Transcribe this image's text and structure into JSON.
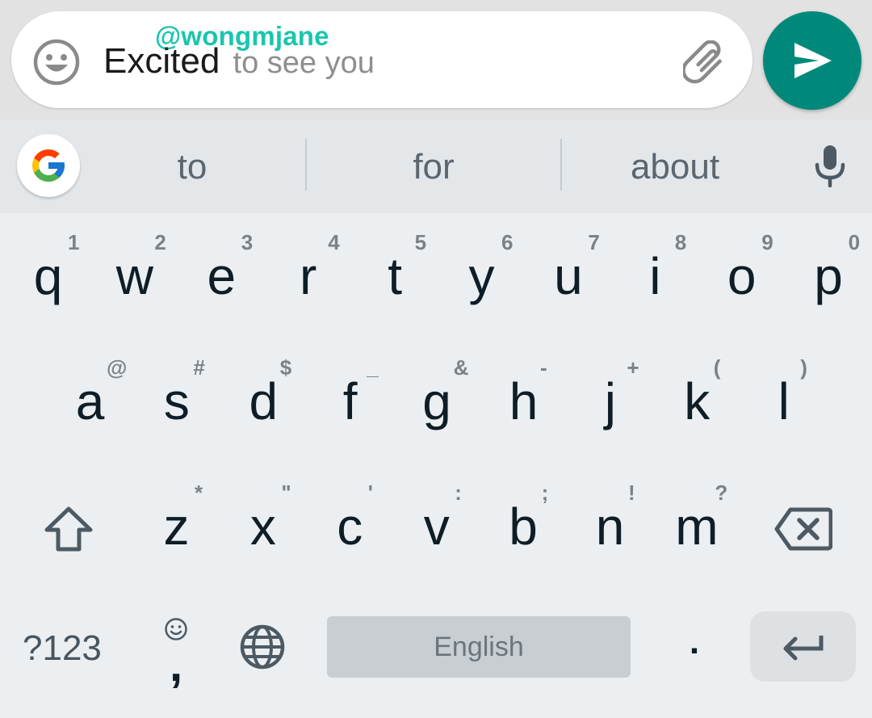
{
  "compose": {
    "mention": "@wongmjane",
    "typed_text": "Excited",
    "completion_text": "to see you",
    "emoji_icon": "smiley-face-icon",
    "attach_icon": "paperclip-icon",
    "send_icon": "send-arrow-icon",
    "send_color": "#00897b",
    "mention_color": "#1bc5ad"
  },
  "suggestions": {
    "google_icon": "google-g-icon",
    "items": [
      "to",
      "for",
      "about"
    ],
    "mic_icon": "microphone-icon"
  },
  "keyboard": {
    "row1": [
      {
        "key": "q",
        "hint": "1"
      },
      {
        "key": "w",
        "hint": "2"
      },
      {
        "key": "e",
        "hint": "3"
      },
      {
        "key": "r",
        "hint": "4"
      },
      {
        "key": "t",
        "hint": "5"
      },
      {
        "key": "y",
        "hint": "6"
      },
      {
        "key": "u",
        "hint": "7"
      },
      {
        "key": "i",
        "hint": "8"
      },
      {
        "key": "o",
        "hint": "9"
      },
      {
        "key": "p",
        "hint": "0"
      }
    ],
    "row2": [
      {
        "key": "a",
        "hint": "@"
      },
      {
        "key": "s",
        "hint": "#"
      },
      {
        "key": "d",
        "hint": "$"
      },
      {
        "key": "f",
        "hint": "_"
      },
      {
        "key": "g",
        "hint": "&"
      },
      {
        "key": "h",
        "hint": "-"
      },
      {
        "key": "j",
        "hint": "+"
      },
      {
        "key": "k",
        "hint": "("
      },
      {
        "key": "l",
        "hint": ")"
      }
    ],
    "row3": [
      {
        "key": "z",
        "hint": "*"
      },
      {
        "key": "x",
        "hint": "\""
      },
      {
        "key": "c",
        "hint": "'"
      },
      {
        "key": "v",
        "hint": ":"
      },
      {
        "key": "b",
        "hint": ";"
      },
      {
        "key": "n",
        "hint": "!"
      },
      {
        "key": "m",
        "hint": "?"
      }
    ],
    "shift_icon": "shift-arrow-icon",
    "backspace_icon": "backspace-icon",
    "bottom": {
      "symbols_label": "?123",
      "comma_label": ",",
      "comma_hint_icon": "emoji-smiley-icon",
      "globe_icon": "globe-icon",
      "space_label": "English",
      "period_label": ".",
      "enter_icon": "enter-return-icon"
    }
  }
}
